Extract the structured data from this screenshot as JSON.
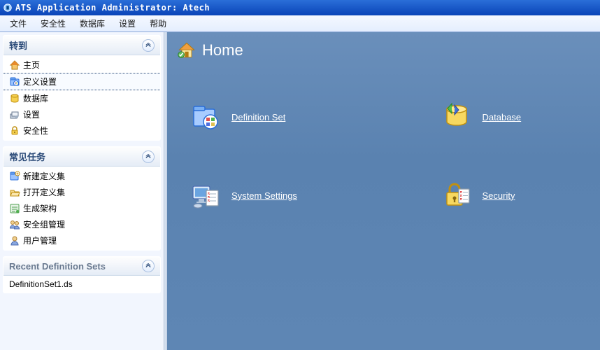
{
  "titlebar": {
    "text": "ATS Application Administrator: Atech"
  },
  "menubar": {
    "items": [
      "文件",
      "安全性",
      "数据库",
      "设置",
      "帮助"
    ]
  },
  "sidebar": {
    "panel_goto": {
      "title": "转到",
      "items": [
        {
          "label": "主页",
          "icon": "home"
        },
        {
          "label": "定义设置",
          "icon": "definition"
        },
        {
          "label": "数据库",
          "icon": "database"
        },
        {
          "label": "设置",
          "icon": "settings"
        },
        {
          "label": "安全性",
          "icon": "security"
        }
      ],
      "selected_index": 1
    },
    "panel_tasks": {
      "title": "常见任务",
      "items": [
        {
          "label": "新建定义集",
          "icon": "new-def"
        },
        {
          "label": "打开定义集",
          "icon": "open-def"
        },
        {
          "label": "生成架构",
          "icon": "gen-schema"
        },
        {
          "label": "安全组管理",
          "icon": "sec-group"
        },
        {
          "label": "用户管理",
          "icon": "user-mgmt"
        }
      ]
    },
    "panel_recent": {
      "title": "Recent Definition Sets",
      "items": [
        {
          "label": "DefinitionSet1.ds"
        }
      ]
    }
  },
  "main": {
    "title": "Home",
    "tiles": [
      {
        "label": "Definition Set",
        "key": "definition-set"
      },
      {
        "label": "Database",
        "key": "database"
      },
      {
        "label": "System Settings",
        "key": "system-settings"
      },
      {
        "label": "Security",
        "key": "security"
      }
    ]
  }
}
